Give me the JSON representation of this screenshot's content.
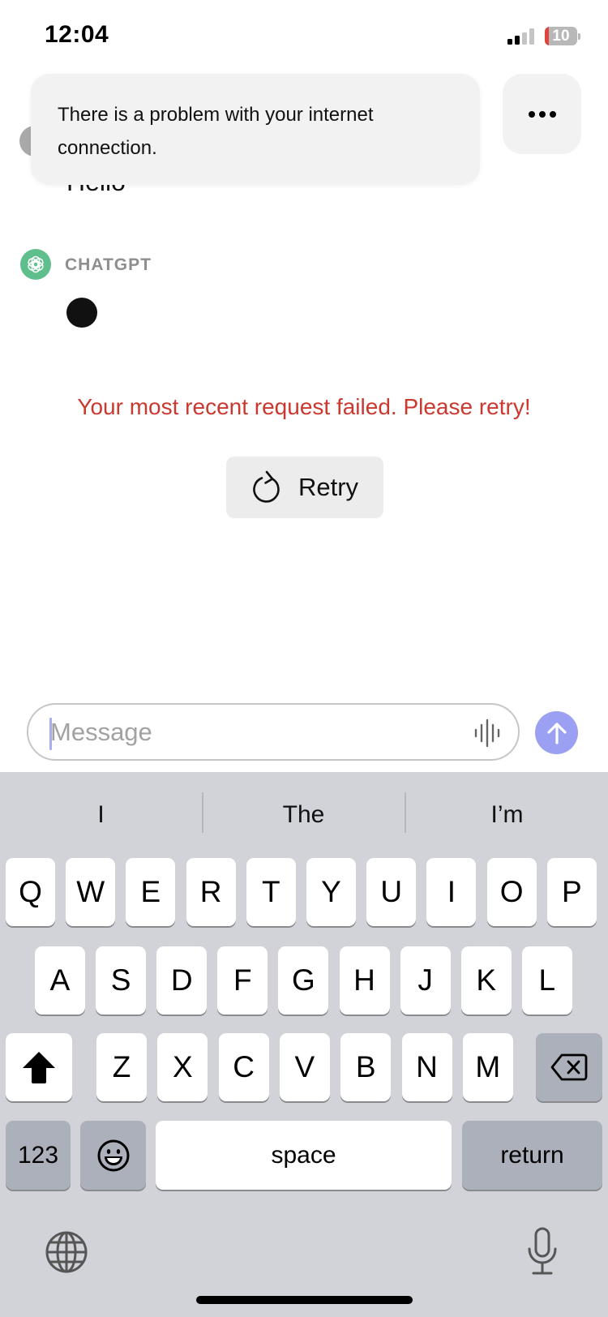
{
  "status_bar": {
    "time": "12:04",
    "signal_bars_filled": 2,
    "signal_bars_total": 4,
    "battery_percent": "10",
    "colors": {
      "battery_low": "#e0443e"
    }
  },
  "toast": {
    "message": "There is a problem with your internet connection.",
    "menu_icon": "more-horizontal-icon"
  },
  "conversation": {
    "user_message": "Hello",
    "assistant_name": "CHATGPT",
    "assistant_avatar_icon": "openai-logo-icon",
    "assistant_status": "typing-indicator",
    "colors": {
      "assistant_avatar": "#5fbf8c"
    }
  },
  "error": {
    "message": "Your most recent request failed. Please retry!",
    "color": "#c9392f",
    "retry_label": "Retry",
    "retry_icon": "refresh-icon"
  },
  "composer": {
    "value": "",
    "placeholder": "Message",
    "voice_icon": "waveform-icon",
    "send_icon": "arrow-up-icon",
    "colors": {
      "send_button": "#9ba0f2"
    }
  },
  "keyboard": {
    "suggestions": [
      "I",
      "The",
      "I’m"
    ],
    "row1": [
      "Q",
      "W",
      "E",
      "R",
      "T",
      "Y",
      "U",
      "I",
      "O",
      "P"
    ],
    "row2": [
      "A",
      "S",
      "D",
      "F",
      "G",
      "H",
      "J",
      "K",
      "L"
    ],
    "row3": [
      "Z",
      "X",
      "C",
      "V",
      "B",
      "N",
      "M"
    ],
    "numbers_label": "123",
    "space_label": "space",
    "return_label": "return",
    "shift_icon": "shift-icon",
    "backspace_icon": "backspace-icon",
    "emoji_icon": "emoji-icon",
    "globe_icon": "globe-icon",
    "dictation_icon": "microphone-icon"
  }
}
